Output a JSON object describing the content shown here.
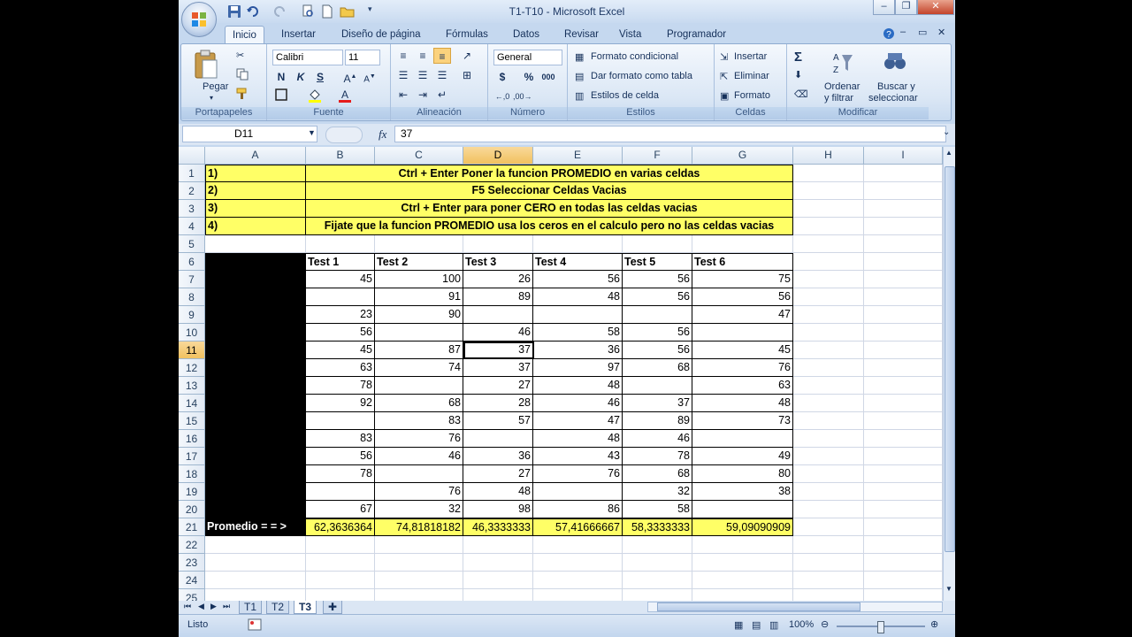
{
  "window": {
    "title": "T1-T10 - Microsoft Excel"
  },
  "tabs": [
    "Inicio",
    "Insertar",
    "Diseño de página",
    "Fórmulas",
    "Datos",
    "Revisar",
    "Vista",
    "Programador"
  ],
  "ribbon": {
    "portapapeles": {
      "paste": "Pegar",
      "label": "Portapapeles"
    },
    "fuente": {
      "font": "Calibri",
      "size": "11",
      "label": "Fuente"
    },
    "alineacion": {
      "label": "Alineación"
    },
    "numero": {
      "format": "General",
      "label": "Número"
    },
    "estilos": {
      "cond": "Formato condicional",
      "table": "Dar formato como tabla",
      "cell": "Estilos de celda",
      "label": "Estilos"
    },
    "celdas": {
      "insert": "Insertar",
      "delete": "Eliminar",
      "format": "Formato",
      "label": "Celdas"
    },
    "modificar": {
      "sort1": "Ordenar",
      "sort2": "y filtrar",
      "find1": "Buscar y",
      "find2": "seleccionar",
      "label": "Modificar"
    }
  },
  "formula_bar": {
    "name_box": "D11",
    "fx": "fx",
    "value": "37"
  },
  "columns": [
    "A",
    "B",
    "C",
    "D",
    "E",
    "F",
    "G",
    "H",
    "I"
  ],
  "selected": {
    "column": "D",
    "row": "11"
  },
  "rows_visible": [
    "1",
    "2",
    "3",
    "4",
    "5",
    "6",
    "7",
    "8",
    "9",
    "10",
    "11",
    "12",
    "13",
    "14",
    "15",
    "16",
    "17",
    "18",
    "19",
    "20",
    "21",
    "22",
    "23",
    "24",
    "25"
  ],
  "sheet": {
    "notes": [
      {
        "num": "1)",
        "text": "Ctrl + Enter Poner la funcion PROMEDIO en varias celdas"
      },
      {
        "num": "2)",
        "text": "F5 Seleccionar Celdas Vacias"
      },
      {
        "num": "3)",
        "text": "Ctrl + Enter para poner CERO en todas las celdas vacias"
      },
      {
        "num": "4)",
        "text": "Fijate que la funcion PROMEDIO usa los ceros en el calculo pero no las celdas vacias"
      }
    ],
    "headers": [
      "Test 1",
      "Test 2",
      "Test 3",
      "Test 4",
      "Test 5",
      "Test 6"
    ],
    "data": [
      [
        "45",
        "100",
        "26",
        "56",
        "56",
        "75"
      ],
      [
        "",
        "91",
        "89",
        "48",
        "56",
        "56"
      ],
      [
        "23",
        "90",
        "",
        "",
        "",
        "47"
      ],
      [
        "56",
        "",
        "46",
        "58",
        "56",
        ""
      ],
      [
        "45",
        "87",
        "37",
        "36",
        "56",
        "45"
      ],
      [
        "63",
        "74",
        "37",
        "97",
        "68",
        "76"
      ],
      [
        "78",
        "",
        "27",
        "48",
        "",
        "63"
      ],
      [
        "92",
        "68",
        "28",
        "46",
        "37",
        "48"
      ],
      [
        "",
        "83",
        "57",
        "47",
        "89",
        "73"
      ],
      [
        "83",
        "76",
        "",
        "48",
        "46",
        ""
      ],
      [
        "56",
        "46",
        "36",
        "43",
        "78",
        "49"
      ],
      [
        "78",
        "",
        "27",
        "76",
        "68",
        "80"
      ],
      [
        "",
        "76",
        "48",
        "",
        "32",
        "38"
      ],
      [
        "67",
        "32",
        "98",
        "86",
        "58",
        ""
      ]
    ],
    "promedio_label": "Promedio = = >",
    "promedio": [
      "62,3636364",
      "74,81818182",
      "46,3333333",
      "57,41666667",
      "58,3333333",
      "59,09090909"
    ]
  },
  "sheet_tabs": [
    "T1",
    "T2",
    "T3"
  ],
  "active_sheet": "T3",
  "status": {
    "ready": "Listo",
    "zoom": "100%"
  }
}
